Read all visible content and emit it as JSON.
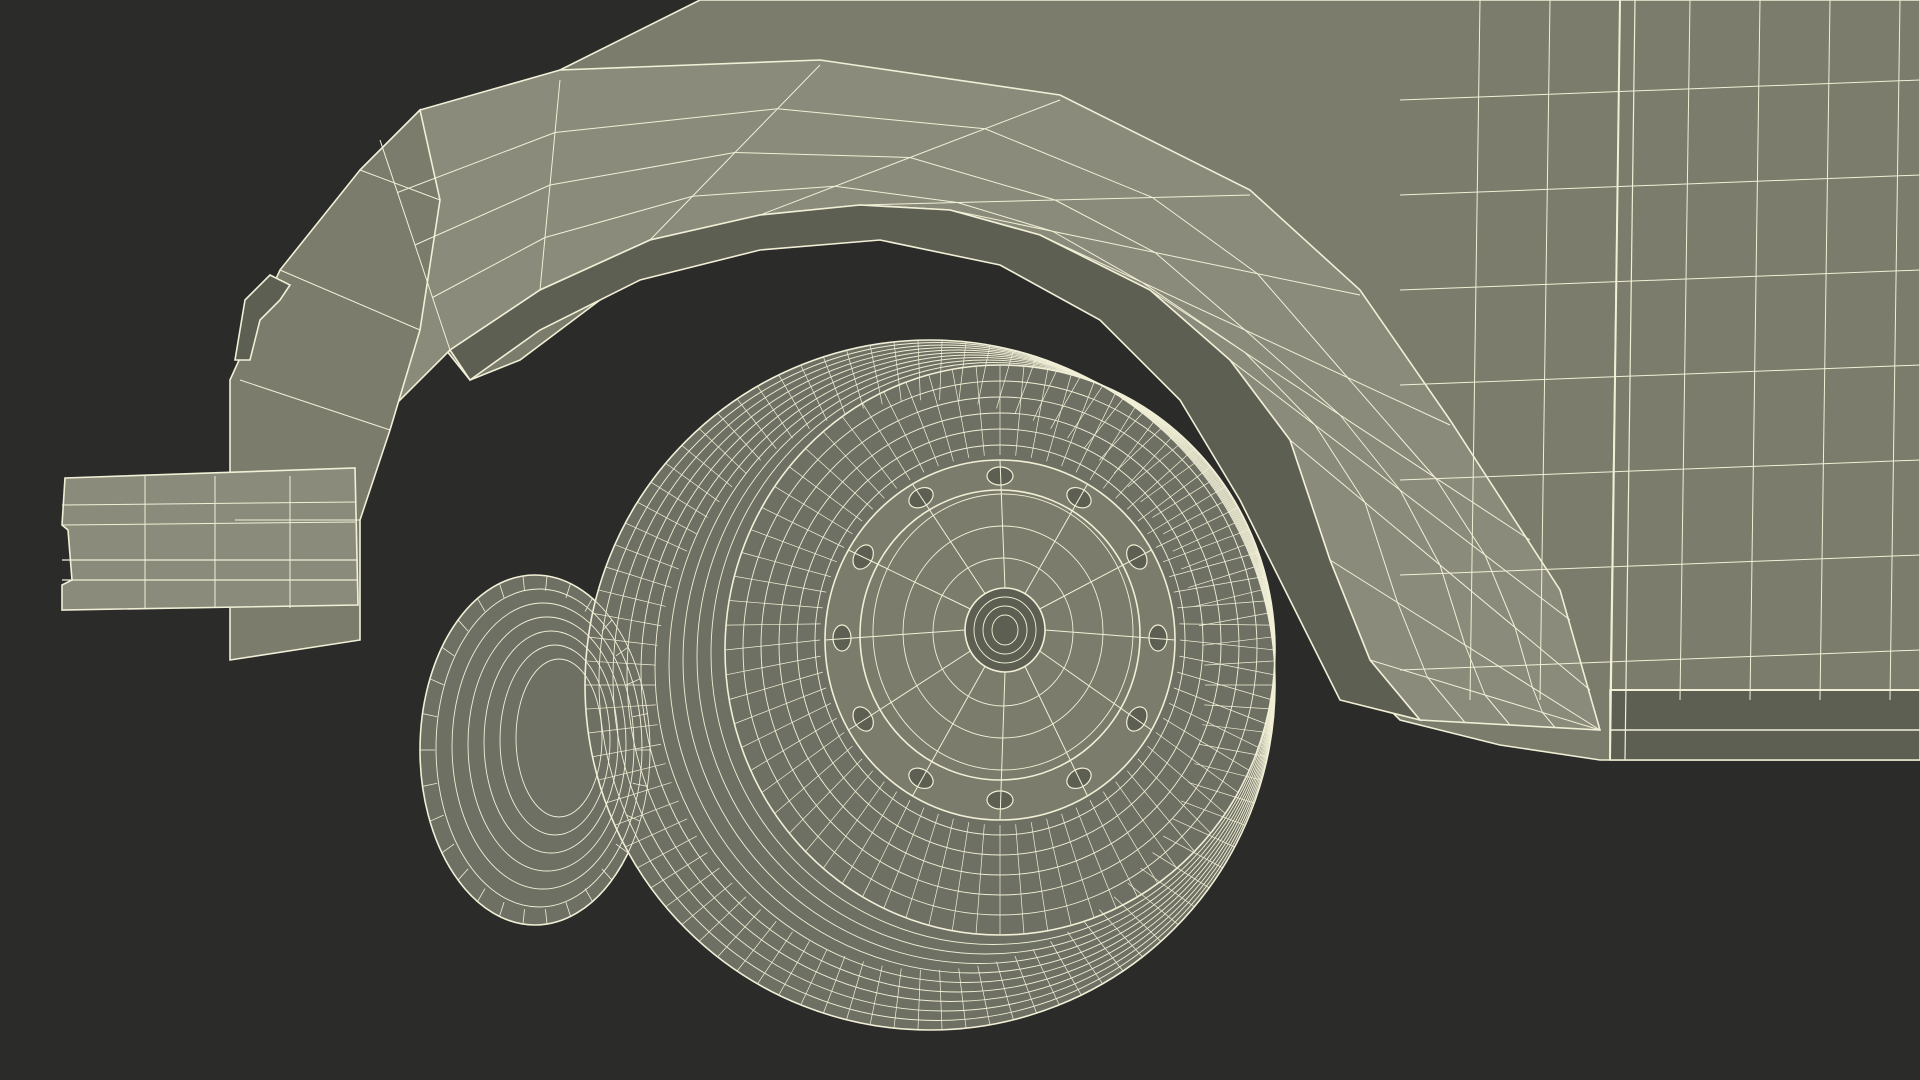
{
  "scene": {
    "background_color": "#2b2b2a",
    "surface_color": "#7b7c6c",
    "surface_shadow_color": "#5e5f53",
    "surface_highlight_color": "#8a8b7b",
    "wire_color": "#f1efd6",
    "tire_color": "#6f7064"
  }
}
